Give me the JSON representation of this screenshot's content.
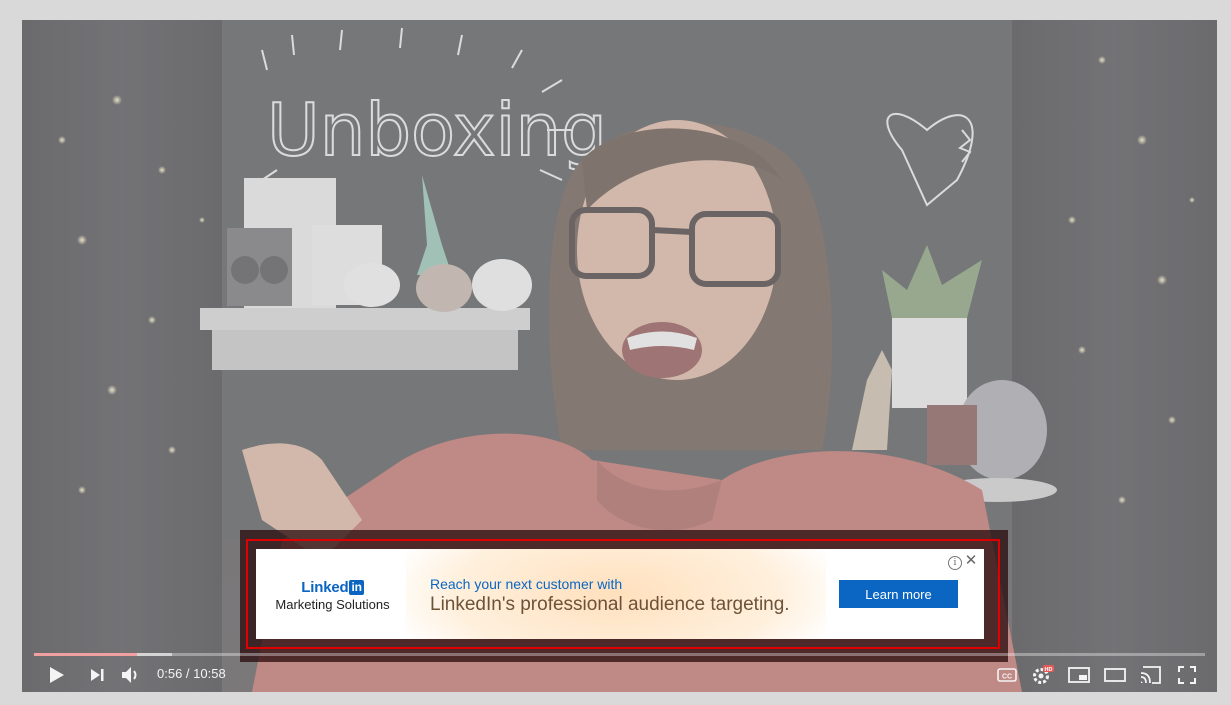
{
  "video": {
    "chalkboard_text": "Unboxing"
  },
  "ad": {
    "brand_name": "Linked",
    "brand_badge": "in",
    "brand_subtitle": "Marketing Solutions",
    "headline": "Reach your next customer with",
    "body": "LinkedIn's professional audience targeting.",
    "cta_label": "Learn more",
    "info_glyph": "i",
    "close_glyph": "✕",
    "colors": {
      "brand": "#0a66c2",
      "highlight_border": "#e00000"
    }
  },
  "player": {
    "progress_played": 0.0883,
    "progress_loaded": 0.118,
    "current_time": "0:56",
    "duration": "10:58",
    "time_separator": " / ",
    "progress_color": "#f0a0a0",
    "hd_badge": "HD",
    "controls_left": [
      "play-icon",
      "next-icon",
      "volume-icon"
    ],
    "controls_right": [
      "subtitles-icon",
      "settings-icon",
      "miniplayer-icon",
      "theater-mode-icon",
      "cast-icon",
      "fullscreen-icon"
    ]
  }
}
